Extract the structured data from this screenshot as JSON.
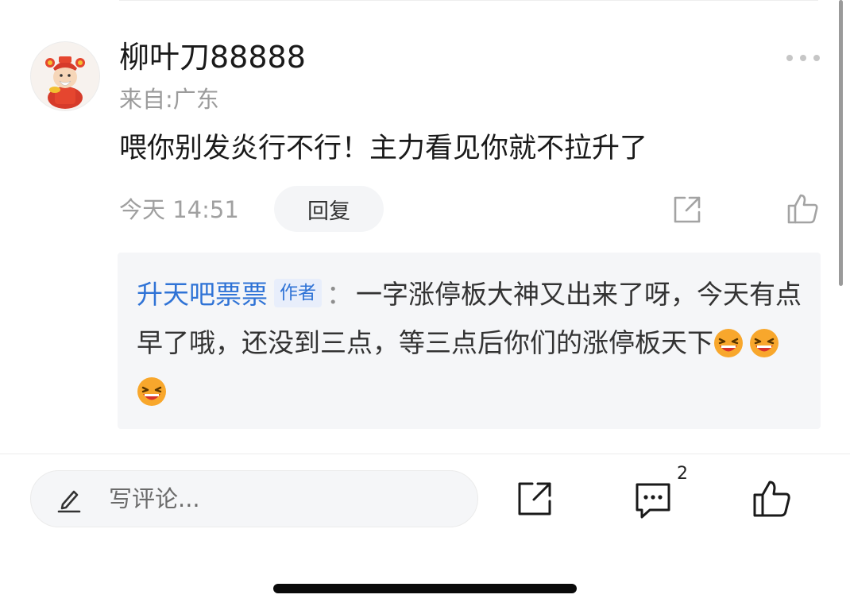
{
  "comment": {
    "username": "柳叶刀88888",
    "location": "来自:广东",
    "text": "喂你别发炎行不行！主力看见你就不拉升了",
    "timestamp": "今天 14:51",
    "reply_label": "回复"
  },
  "reply": {
    "author": "升天吧票票",
    "badge": "作者",
    "colon": "：",
    "text": "一字涨停板大神又出来了呀，今天有点早了哦，还没到三点，等三点后你们的涨停板天下",
    "emoji_count": 3
  },
  "bottom_bar": {
    "input_placeholder": "写评论...",
    "comment_count": "2"
  },
  "icons": [
    "more-icon",
    "share-icon",
    "like-icon",
    "pen-icon",
    "comment-icon",
    "laughing-emoji"
  ]
}
